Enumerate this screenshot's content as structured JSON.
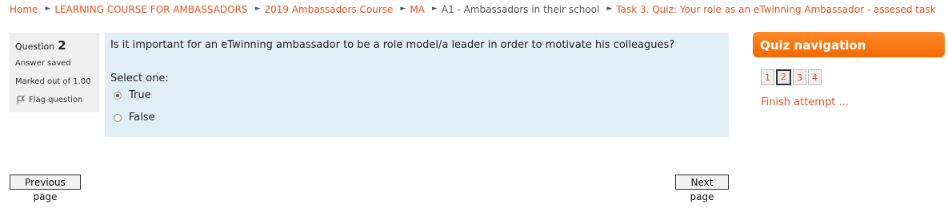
{
  "breadcrumb": [
    {
      "label": "Home",
      "link": true
    },
    {
      "label": "LEARNING COURSE FOR AMBASSADORS",
      "link": true
    },
    {
      "label": "2019 Ambassadors Course",
      "link": true
    },
    {
      "label": "MA",
      "link": true
    },
    {
      "label": "A1 - Ambassadors in their school",
      "link": false
    },
    {
      "label": "Task 3. Quiz: Your role as an eTwinning Ambassador - assesed task",
      "link": true
    }
  ],
  "separator_icon": "triangle-right",
  "question_info": {
    "label": "Question",
    "number": "2",
    "state": "Answer saved",
    "grade": "Marked out of 1.00",
    "flag_label": "Flag question"
  },
  "question": {
    "text": "Is it important for an eTwinning ambassador to be a role model/a leader in order to motivate his colleagues?",
    "prompt": "Select one:",
    "options": [
      {
        "label": "True",
        "selected": true
      },
      {
        "label": "False",
        "selected": false
      }
    ]
  },
  "nav": {
    "previous_label": "Previous page",
    "next_label": "Next page"
  },
  "quiz_navigation": {
    "title": "Quiz navigation",
    "questions": [
      "1",
      "2",
      "3",
      "4"
    ],
    "current": "2",
    "finish_label": "Finish attempt ..."
  },
  "colors": {
    "link": "#e8501d",
    "header": "#f06a00",
    "question_bg": "#e0eef8",
    "info_bg": "#efefef"
  }
}
